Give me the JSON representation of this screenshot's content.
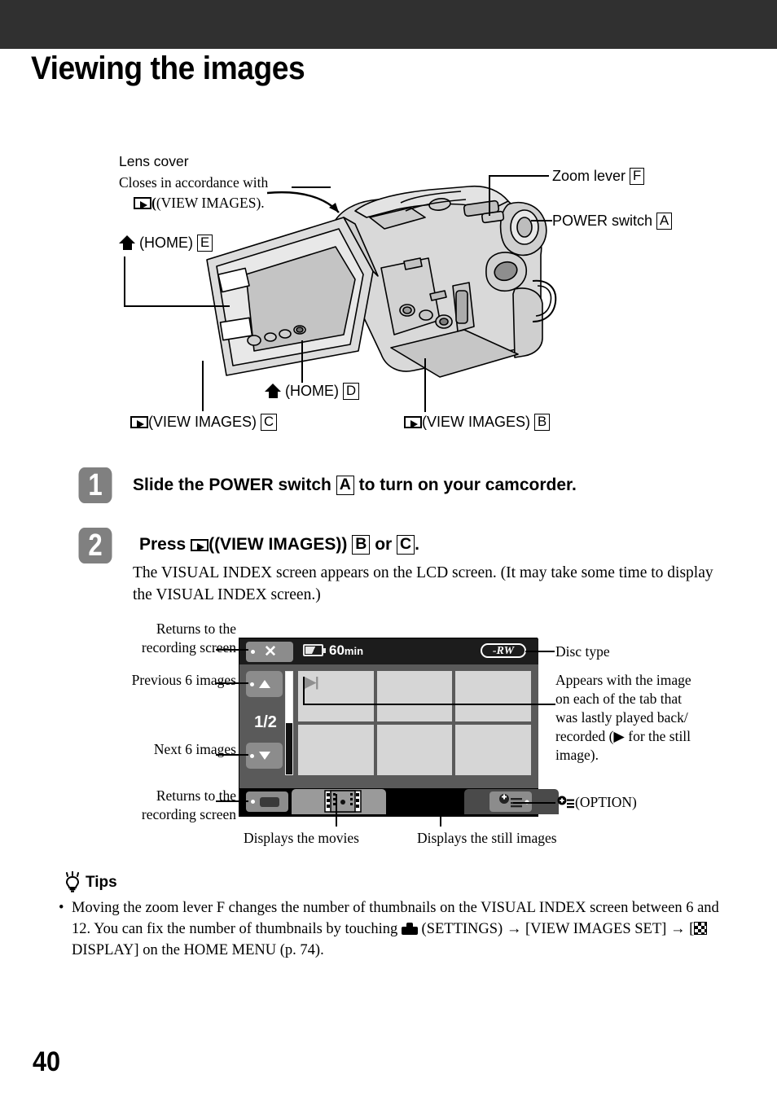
{
  "page": {
    "title": "Viewing the images",
    "number": "40"
  },
  "diagram": {
    "lens_cover_title": "Lens cover",
    "lens_cover_desc_line1": "Closes in accordance with",
    "lens_cover_desc_line2": "(VIEW IMAGES).",
    "home_e": "(HOME)",
    "home_e_ref": "E",
    "zoom_lever": "Zoom lever",
    "zoom_lever_ref": "F",
    "power_switch": "POWER switch",
    "power_switch_ref": "A",
    "home_d": "(HOME)",
    "home_d_ref": "D",
    "view_images_c": "(VIEW IMAGES)",
    "view_images_c_ref": "C",
    "view_images_b": "(VIEW IMAGES)",
    "view_images_b_ref": "B"
  },
  "steps": [
    {
      "number": "1",
      "head_pre": "Slide the POWER switch",
      "head_ref": "A",
      "head_post": "to turn on your camcorder."
    },
    {
      "number": "2",
      "head_pre": "Press",
      "head_mid": "(VIEW IMAGES)",
      "head_ref_b": "B",
      "head_or": "or",
      "head_ref_c": "C",
      "head_end": ".",
      "body_line1": "The VISUAL INDEX screen appears on the LCD screen. (It may take some time to",
      "body_line2": "display the VISUAL INDEX screen.)"
    }
  ],
  "lcd": {
    "battery_time": "60",
    "battery_unit": "min",
    "disc_type_text": "-RW",
    "page_count": "1/2",
    "close_icon": "close-x-icon",
    "up_icon": "triangle-up-icon",
    "down_icon": "triangle-down-icon",
    "play_marker": "|▶|",
    "movie_tab_icon": "filmstrip-icon",
    "still_tab_icon": "camera-icon",
    "return_icon": "recording-screen-icon",
    "option_icon": "option-icon"
  },
  "callouts": {
    "return_top_line1": "Returns to the",
    "return_top_line2": "recording screen",
    "previous6": "Previous 6 images",
    "next6": "Next 6 images",
    "return_bottom_line1": "Returns to the",
    "return_bottom_line2": "recording screen",
    "disc_type": "Disc type",
    "tab_note_l1": "Appears with the image",
    "tab_note_l2": "on each of the tab that",
    "tab_note_l3": "was lastly played back/",
    "tab_note_l4": "recorded (▶ for the still",
    "tab_note_l5": "image).",
    "displays_movies": "Displays the movies",
    "displays_stills": "Displays the still images",
    "option_label": "(OPTION)"
  },
  "tips": {
    "heading": "Tips",
    "bullet": "•",
    "t1": "Moving the zoom lever F changes the number of thumbnails on the VISUAL INDEX screen between 6",
    "t2a": "and 12. You can fix the number of thumbnails by touching",
    "t2b": "(SETTINGS)",
    "t2arrow": "→",
    "t2c": "[VIEW IMAGES SET]",
    "t3arrow": "→",
    "t3a": "[",
    "t3b": "DISPLAY] on the HOME MENU (p. 74).",
    "settings_icon": "toolbox-icon",
    "display_icon": "checker-display-icon"
  },
  "colors": {
    "header_band": "#303030",
    "step_badge": "#808080",
    "lcd_bg": "#000000",
    "lcd_body": "#5a5a5a",
    "lcd_button": "#8c8c8c",
    "thumbnail": "#d6d6d6"
  }
}
